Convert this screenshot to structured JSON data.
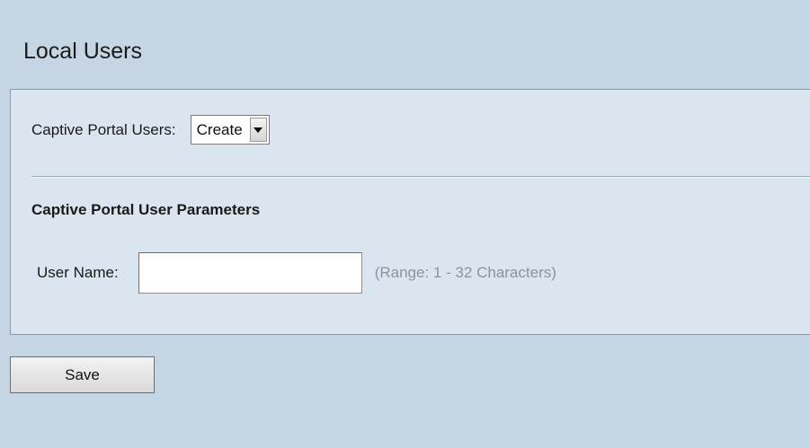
{
  "page": {
    "title": "Local Users"
  },
  "captive_portal": {
    "label": "Captive Portal Users:",
    "select_value": "Create"
  },
  "parameters": {
    "section_title": "Captive Portal User Parameters",
    "user_name_label": "User Name:",
    "user_name_value": "",
    "user_name_hint": "(Range: 1 - 32 Characters)"
  },
  "actions": {
    "save_label": "Save"
  },
  "colors": {
    "background": "#c5d5e4",
    "panel": "#dae5ef",
    "hint_text": "#8d9398"
  },
  "icons": {
    "select_arrow": "chevron-down-icon"
  }
}
